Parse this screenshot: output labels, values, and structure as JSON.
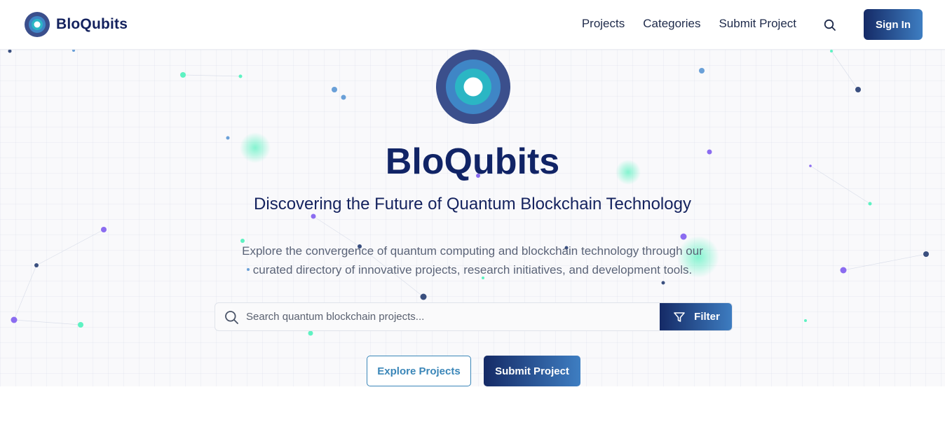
{
  "nav": {
    "brand": "BloQubits",
    "links": [
      "Projects",
      "Categories",
      "Submit Project"
    ],
    "search_icon": "search-icon",
    "signin_label": "Sign In"
  },
  "hero": {
    "title": "BloQubits",
    "subtitle": "Discovering the Future of Quantum Blockchain Technology",
    "description": "Explore the convergence of quantum computing and blockchain technology through our curated directory of innovative projects, research initiatives, and development tools.",
    "search_placeholder": "Search quantum blockchain projects...",
    "filter_label": "Filter",
    "explore_label": "Explore Projects",
    "submit_label": "Submit Project"
  },
  "colors": {
    "primary_dark": "#152a66",
    "primary_light": "#3e7ec2",
    "accent_teal": "#2bb6c4",
    "logo_outer": "#3b4f8c",
    "particle_green": "#5ef2c2",
    "particle_purple": "#8b6cf0",
    "particle_blue": "#6aa0d8",
    "particle_navy": "#3a4f7f"
  },
  "icons": {
    "brand_logo": "bloqubits-logo-icon",
    "search": "search-icon",
    "filter": "filter-icon"
  }
}
